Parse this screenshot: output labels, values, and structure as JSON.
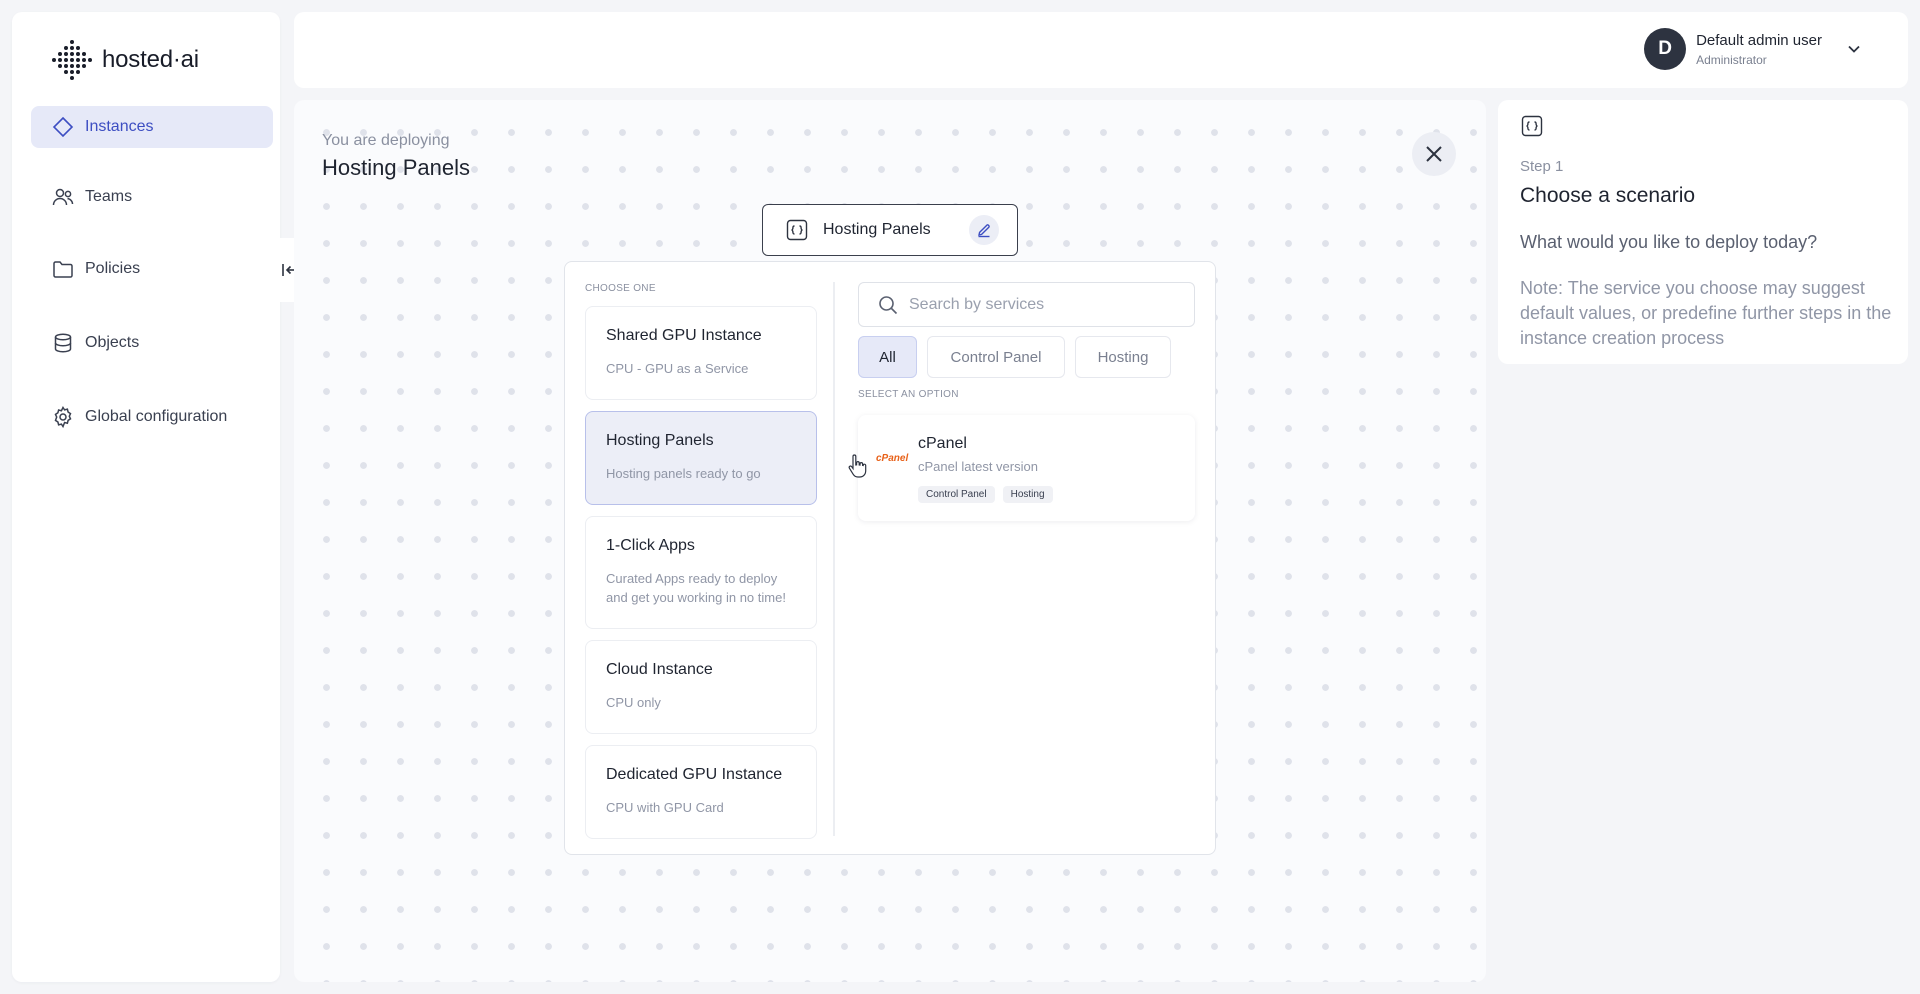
{
  "brand": {
    "name": "hosted·ai"
  },
  "sidebar": {
    "items": [
      {
        "label": "Instances",
        "icon": "diamond-icon",
        "active": true
      },
      {
        "label": "Teams",
        "icon": "users-icon",
        "active": false
      },
      {
        "label": "Policies",
        "icon": "folder-icon",
        "active": false
      },
      {
        "label": "Objects",
        "icon": "cylinder-icon",
        "active": false
      },
      {
        "label": "Global configuration",
        "icon": "gear-icon",
        "active": false
      }
    ]
  },
  "user": {
    "initial": "D",
    "name": "Default admin user",
    "role": "Administrator"
  },
  "deploy": {
    "label": "You are deploying",
    "title": "Hosting Panels",
    "scenario_pill": "Hosting Panels"
  },
  "chooser": {
    "choose_one": "CHOOSE ONE",
    "options": [
      {
        "title": "Shared GPU Instance",
        "subtitle": "CPU - GPU as a Service",
        "selected": false
      },
      {
        "title": "Hosting Panels",
        "subtitle": "Hosting panels ready to go",
        "selected": true
      },
      {
        "title": "1-Click Apps",
        "subtitle": "Curated Apps ready to deploy and get you working in no time!",
        "selected": false
      },
      {
        "title": "Cloud Instance",
        "subtitle": "CPU only",
        "selected": false
      },
      {
        "title": "Dedicated GPU Instance",
        "subtitle": "CPU with GPU Card",
        "selected": false
      }
    ],
    "search_placeholder": "Search by services",
    "filters": [
      {
        "label": "All",
        "active": true
      },
      {
        "label": "Control Panel",
        "active": false
      },
      {
        "label": "Hosting",
        "active": false
      }
    ],
    "select_option": "SELECT AN OPTION",
    "cards": [
      {
        "logo_text": "cPanel",
        "title": "cPanel",
        "subtitle": "cPanel latest version",
        "tags": [
          "Control Panel",
          "Hosting"
        ]
      }
    ]
  },
  "steps": {
    "step": "Step 1",
    "title": "Choose a scenario",
    "question": "What would you like to deploy today?",
    "note": "Note: The service you choose may suggest default values, or predefine further steps in the instance creation process"
  },
  "colors": {
    "accent": "#3d4ec2",
    "active_bg": "#e6e9f8",
    "cpanel_orange": "#e8621a"
  }
}
